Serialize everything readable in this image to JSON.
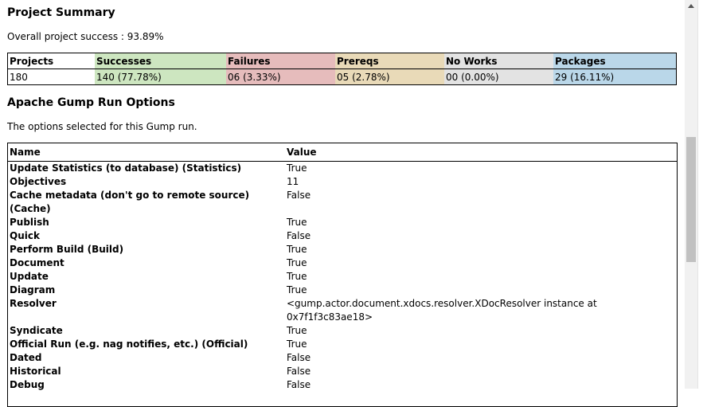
{
  "summary": {
    "title": "Project Summary",
    "overall_label": "Overall project success : 93.89%",
    "headers": [
      "Projects",
      "Successes",
      "Failures",
      "Prereqs",
      "No Works",
      "Packages"
    ],
    "values": [
      "180",
      "140 (77.78%)",
      "06 (3.33%)",
      "05 (2.78%)",
      "00 (0.00%)",
      "29 (16.11%)"
    ],
    "colors": {
      "successes": "#cde6c0",
      "failures": "#e6bcbc",
      "prereqs": "#e9dab8",
      "no_works": "#e3e3e3",
      "packages": "#bad7e9"
    }
  },
  "options": {
    "title": "Apache Gump Run Options",
    "description": "The options selected for this Gump run.",
    "col_name": "Name",
    "col_value": "Value",
    "rows": [
      {
        "name": "Update Statistics (to database) (Statistics)",
        "value": "True"
      },
      {
        "name": "Objectives",
        "value": "11"
      },
      {
        "name": "Cache metadata (don't go to remote source) (Cache)",
        "value": "False"
      },
      {
        "name": "Publish",
        "value": "True"
      },
      {
        "name": "Quick",
        "value": "False"
      },
      {
        "name": "Perform Build (Build)",
        "value": "True"
      },
      {
        "name": "Document",
        "value": "True"
      },
      {
        "name": "Update",
        "value": "True"
      },
      {
        "name": "Diagram",
        "value": "True"
      },
      {
        "name": "Resolver",
        "value": "<gump.actor.document.xdocs.resolver.XDocResolver instance at 0x7f1f3c83ae18>"
      },
      {
        "name": "Syndicate",
        "value": "True"
      },
      {
        "name": "Official Run (e.g. nag notifies, etc.) (Official)",
        "value": "True"
      },
      {
        "name": "Dated",
        "value": "False"
      },
      {
        "name": "Historical",
        "value": "False"
      },
      {
        "name": "Debug",
        "value": "False"
      }
    ]
  }
}
